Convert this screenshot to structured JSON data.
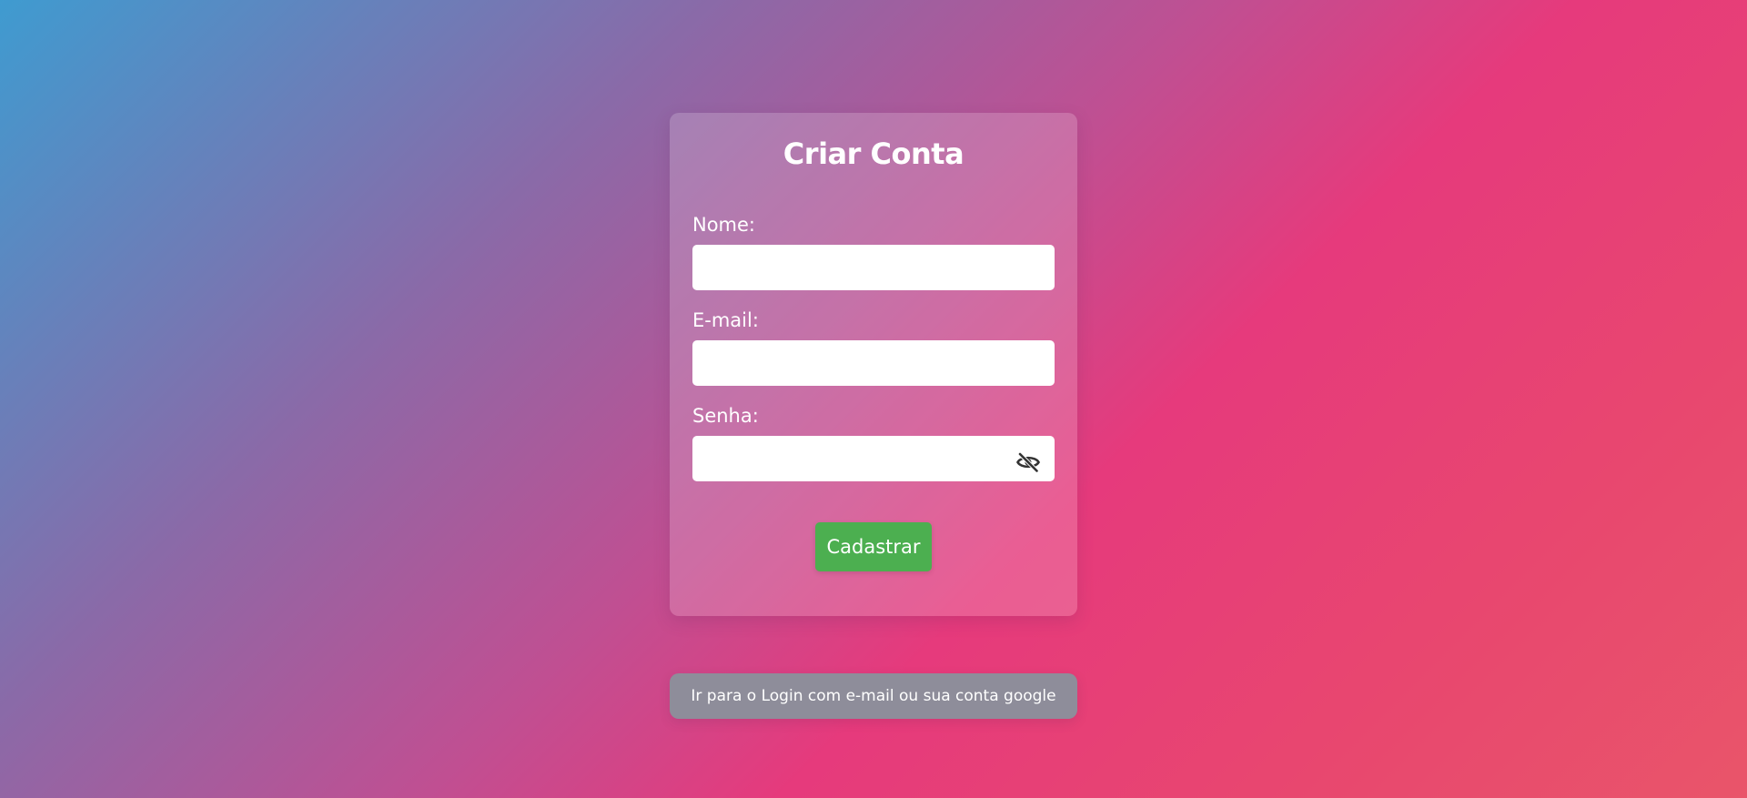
{
  "form": {
    "title": "Criar Conta",
    "fields": [
      {
        "label": "Nome:",
        "value": "",
        "placeholder": ""
      },
      {
        "label": "E-mail:",
        "value": "",
        "placeholder": ""
      },
      {
        "label": "Senha:",
        "value": "",
        "placeholder": ""
      }
    ],
    "password_toggle_icon": "eye-slash-icon",
    "submit_label": "Cadastrar"
  },
  "login_link": {
    "label": "Ir para o Login com e-mail ou sua conta google"
  },
  "colors": {
    "submit_button": "#4caf50",
    "login_link_bg": "#8e8d9a",
    "card_bg": "rgba(255,255,255,0.18)",
    "gradient_start": "#3f9bd0",
    "gradient_mid": "#e63a7c",
    "gradient_end": "#e9556a"
  }
}
